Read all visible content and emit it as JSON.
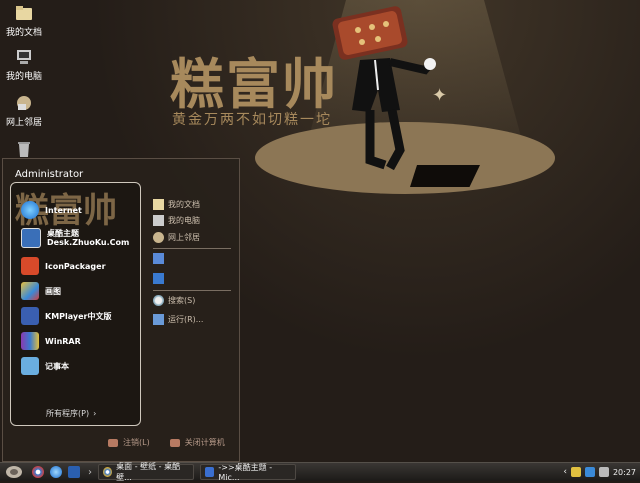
{
  "wallpaper": {
    "headline": "糕富帅",
    "subline": "黄金万两不如切糕一坨"
  },
  "desktop_icons": [
    {
      "label": "我的文档",
      "icon": "folder-icon"
    },
    {
      "label": "我的电脑",
      "icon": "computer-icon"
    },
    {
      "label": "网上邻居",
      "icon": "network-icon"
    },
    {
      "label": "回收站",
      "icon": "recycle-bin-icon"
    }
  ],
  "start_menu": {
    "user": "Administrator",
    "watermark": "糕富帅",
    "programs": [
      {
        "label": "Internet",
        "icon": "internet-explorer-icon"
      },
      {
        "label": "桌酷主题",
        "label2": "Desk.ZhuoKu.Com",
        "icon": "zhuoku-icon"
      },
      {
        "label": "IconPackager",
        "icon": "iconpackager-icon"
      },
      {
        "label": "画图",
        "icon": "paint-icon"
      },
      {
        "label": "KMPlayer中文版",
        "icon": "kmplayer-icon"
      },
      {
        "label": "WinRAR",
        "icon": "winrar-icon"
      },
      {
        "label": "记事本",
        "icon": "notepad-icon"
      }
    ],
    "all_programs": "所有程序(P)",
    "right_items": [
      {
        "label": "我的文档",
        "icon": "folder-icon"
      },
      {
        "label": "我的电脑",
        "icon": "computer-icon"
      },
      {
        "label": "网上邻居",
        "icon": "network-icon"
      },
      {
        "label": "",
        "icon": "control-panel-icon"
      },
      {
        "label": "",
        "icon": "printers-icon"
      },
      {
        "label": "搜索(S)",
        "icon": "search-icon"
      },
      {
        "label": "运行(R)...",
        "icon": "run-icon"
      }
    ],
    "logoff": "注销(L)",
    "shutdown": "关闭计算机"
  },
  "taskbar": {
    "tasks": [
      {
        "label": "桌面 - 壁纸 - 桌酷壁...",
        "icon": "chrome-icon"
      },
      {
        "label": "->>桌酷主题 - Mic...",
        "icon": "word-icon"
      }
    ],
    "clock": "20:27"
  },
  "colors": {
    "accent": "#a7895c",
    "spotlight": "#8c7655",
    "background": "#241d18"
  }
}
